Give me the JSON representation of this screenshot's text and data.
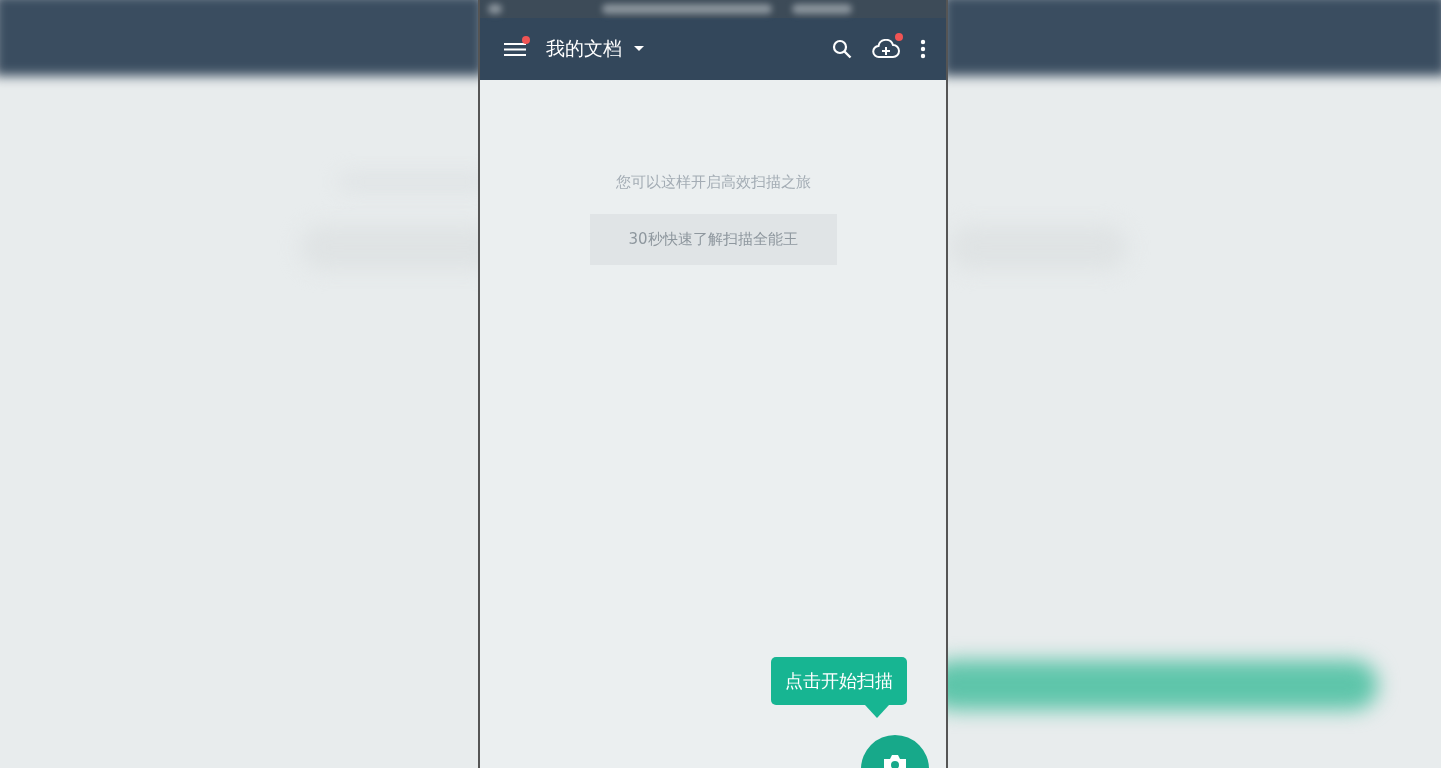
{
  "app_bar": {
    "title": "我的文档",
    "menu_badge": true,
    "upload_badge": true
  },
  "empty_state": {
    "message": "您可以这样开启高效扫描之旅",
    "guide_button": "30秒快速了解扫描全能王"
  },
  "tooltip": {
    "text": "点击开始扫描"
  }
}
